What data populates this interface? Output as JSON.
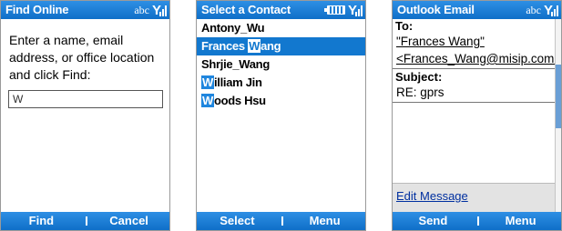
{
  "screens": [
    {
      "title": "Find Online",
      "status_input": "abc",
      "prompt": "Enter a name, email address, or office location and click Find:",
      "search_value": "W",
      "soft_left": "Find",
      "soft_right": "Cancel"
    },
    {
      "title": "Select a Contact",
      "contacts": [
        {
          "pre": "Antony_Wu",
          "hl": "",
          "post": ""
        },
        {
          "pre": "Frances ",
          "hl": "W",
          "post": "ang"
        },
        {
          "pre": "Shrjie_Wang",
          "hl": "",
          "post": ""
        },
        {
          "pre": "",
          "hl": "W",
          "post": "illiam Jin"
        },
        {
          "pre": "",
          "hl": "W",
          "post": "oods Hsu"
        }
      ],
      "soft_left": "Select",
      "soft_right": "Menu"
    },
    {
      "title": "Outlook Email",
      "status_input": "abc",
      "to_label": "To:",
      "to_name": "\"Frances Wang\"",
      "to_email": "<Frances_Wang@misip.com>",
      "subject_label": "Subject:",
      "subject_value": "RE: gprs",
      "edit_link": "Edit Message",
      "soft_left": "Send",
      "soft_right": "Menu"
    }
  ],
  "icons": {
    "signal": "signal-strength-icon",
    "battery": "battery-icon"
  },
  "colors": {
    "title_bar": "#0f6fc8",
    "selection": "#1278cf",
    "highlight": "#1f86de"
  }
}
